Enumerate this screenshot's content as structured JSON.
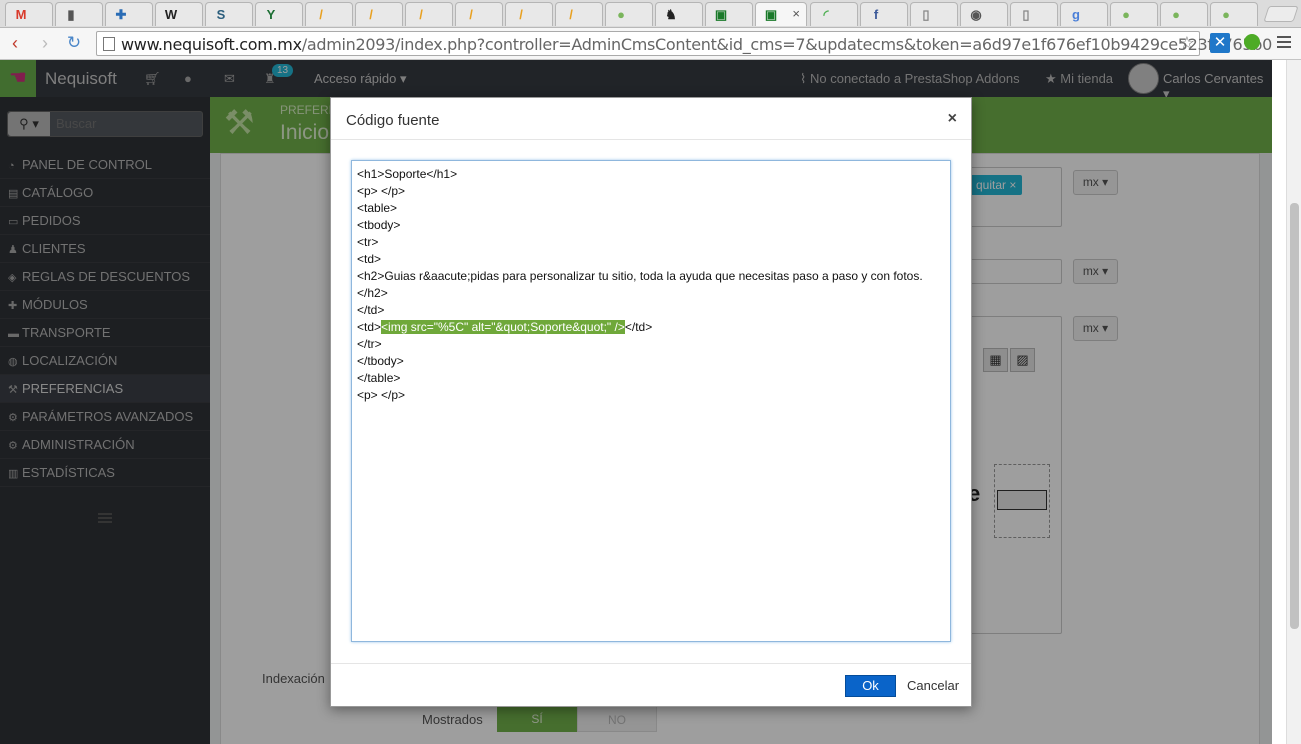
{
  "browser": {
    "url_host": "www.nequisoft.com.mx",
    "url_path": "/admin2093/index.php?controller=AdminCmsContent&id_cms=7&updatecms&token=a6d97e1f676ef10b9429ce523f8765b0",
    "tabs": [
      {
        "icon": "gmail-icon",
        "color": "#d93a2b",
        "glyph": "M"
      },
      {
        "icon": "analytics-icon",
        "color": "#555555",
        "glyph": "▮"
      },
      {
        "icon": "puzzle-icon",
        "color": "#2a6cb5",
        "glyph": "✚"
      },
      {
        "icon": "wikipedia-icon",
        "color": "#222222",
        "glyph": "W"
      },
      {
        "icon": "s-icon",
        "color": "#2a5d7c",
        "glyph": "S"
      },
      {
        "icon": "y-icon",
        "color": "#1c6e33",
        "glyph": "Y"
      },
      {
        "icon": "wrench-icon",
        "color": "#e8a020",
        "glyph": "/"
      },
      {
        "icon": "wrench-icon",
        "color": "#e8a020",
        "glyph": "/"
      },
      {
        "icon": "wrench-icon",
        "color": "#e8a020",
        "glyph": "/"
      },
      {
        "icon": "wrench-icon",
        "color": "#e8a020",
        "glyph": "/"
      },
      {
        "icon": "wrench-icon",
        "color": "#e8a020",
        "glyph": "/"
      },
      {
        "icon": "wrench-icon",
        "color": "#e8a020",
        "glyph": "/"
      },
      {
        "icon": "prestashop-icon",
        "color": "#7ab55c",
        "glyph": "●"
      },
      {
        "icon": "chess-icon",
        "color": "#222222",
        "glyph": "♞"
      },
      {
        "icon": "terminal-icon",
        "color": "#1a7a2a",
        "glyph": "▣"
      },
      {
        "icon": "terminal-icon",
        "color": "#1a7a2a",
        "glyph": "▣"
      },
      {
        "icon": "spinner-icon",
        "color": "#4caf50",
        "glyph": "◜"
      },
      {
        "icon": "facebook-icon",
        "color": "#3b5998",
        "glyph": "f"
      },
      {
        "icon": "page-icon",
        "color": "#888888",
        "glyph": "▯"
      },
      {
        "icon": "gimp-icon",
        "color": "#555555",
        "glyph": "◉"
      },
      {
        "icon": "page-icon",
        "color": "#888888",
        "glyph": "▯"
      },
      {
        "icon": "google-icon",
        "color": "#4a7fd8",
        "glyph": "g"
      },
      {
        "icon": "prestashop-icon",
        "color": "#7ab55c",
        "glyph": "●"
      },
      {
        "icon": "prestashop-icon",
        "color": "#7ab55c",
        "glyph": "●"
      },
      {
        "icon": "prestashop-icon",
        "color": "#7ab55c",
        "glyph": "●"
      }
    ],
    "active_tab_close": "×"
  },
  "topbar": {
    "shop_name": "Nequisoft",
    "notification_count": "13",
    "quick_access": "Acceso rápido",
    "addons": "No conectado a PrestaShop Addons",
    "my_store": "Mi tienda",
    "user": "Carlos Cervantes"
  },
  "sidebar": {
    "search_placeholder": "Buscar",
    "items": [
      {
        "label": "PANEL DE CONTROL",
        "icon": "dashboard-icon",
        "glyph": "◔"
      },
      {
        "label": "CATÁLOGO",
        "icon": "book-icon",
        "glyph": "▤"
      },
      {
        "label": "PEDIDOS",
        "icon": "card-icon",
        "glyph": "▭"
      },
      {
        "label": "CLIENTES",
        "icon": "users-icon",
        "glyph": "♟"
      },
      {
        "label": "REGLAS DE DESCUENTOS",
        "icon": "tag-icon",
        "glyph": "◈"
      },
      {
        "label": "MÓDULOS",
        "icon": "puzzle-icon",
        "glyph": "✚"
      },
      {
        "label": "TRANSPORTE",
        "icon": "truck-icon",
        "glyph": "▬"
      },
      {
        "label": "LOCALIZACIÓN",
        "icon": "globe-icon",
        "glyph": "◍"
      },
      {
        "label": "PREFERENCIAS",
        "icon": "wrench-icon",
        "glyph": "⚒"
      },
      {
        "label": "PARÁMETROS AVANZADOS",
        "icon": "cogs-icon",
        "glyph": "⚙"
      },
      {
        "label": "ADMINISTRACIÓN",
        "icon": "cog-icon",
        "glyph": "⚙"
      },
      {
        "label": "ESTADÍSTICAS",
        "icon": "bar-chart-icon",
        "glyph": "▥"
      }
    ]
  },
  "content": {
    "breadcrumb": "PREFERE",
    "title": "Inicio",
    "tag_label": "quitar",
    "tag_close": "×",
    "lang": "mx",
    "partial_text": "e",
    "indexacion_label": "Indexación",
    "mostrados_label": "Mostrados",
    "toggle_yes": "SÍ",
    "toggle_no": "NO"
  },
  "modal": {
    "title": "Código fuente",
    "close": "×",
    "code_lines": [
      "<h1>Soporte</h1>",
      "<p> </p>",
      "<table>",
      "<tbody>",
      "<tr>",
      "<td>",
      "<h2>Guias r&aacute;pidas para personalizar tu sitio, toda la ayuda que necesitas paso a paso y con fotos.",
      "</h2>",
      "</td>",
      "<td>",
      "</tr>",
      "</tbody>",
      "</table>",
      "<p> </p>"
    ],
    "line10_highlight": "<img src=\"%5C\" alt=\"&quot;Soporte&quot;\" />",
    "line10_tail": "</td>",
    "ok_label": "Ok",
    "cancel_label": "Cancelar"
  }
}
